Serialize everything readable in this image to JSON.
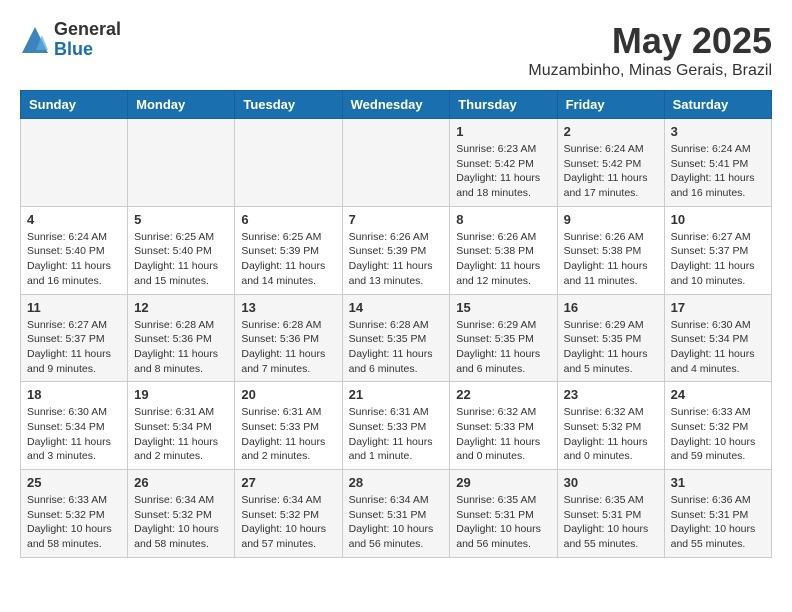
{
  "logo": {
    "general": "General",
    "blue": "Blue"
  },
  "title": "May 2025",
  "location": "Muzambinho, Minas Gerais, Brazil",
  "headers": [
    "Sunday",
    "Monday",
    "Tuesday",
    "Wednesday",
    "Thursday",
    "Friday",
    "Saturday"
  ],
  "weeks": [
    [
      {
        "day": "",
        "info": ""
      },
      {
        "day": "",
        "info": ""
      },
      {
        "day": "",
        "info": ""
      },
      {
        "day": "",
        "info": ""
      },
      {
        "day": "1",
        "info": "Sunrise: 6:23 AM\nSunset: 5:42 PM\nDaylight: 11 hours and 18 minutes."
      },
      {
        "day": "2",
        "info": "Sunrise: 6:24 AM\nSunset: 5:42 PM\nDaylight: 11 hours and 17 minutes."
      },
      {
        "day": "3",
        "info": "Sunrise: 6:24 AM\nSunset: 5:41 PM\nDaylight: 11 hours and 16 minutes."
      }
    ],
    [
      {
        "day": "4",
        "info": "Sunrise: 6:24 AM\nSunset: 5:40 PM\nDaylight: 11 hours and 16 minutes."
      },
      {
        "day": "5",
        "info": "Sunrise: 6:25 AM\nSunset: 5:40 PM\nDaylight: 11 hours and 15 minutes."
      },
      {
        "day": "6",
        "info": "Sunrise: 6:25 AM\nSunset: 5:39 PM\nDaylight: 11 hours and 14 minutes."
      },
      {
        "day": "7",
        "info": "Sunrise: 6:26 AM\nSunset: 5:39 PM\nDaylight: 11 hours and 13 minutes."
      },
      {
        "day": "8",
        "info": "Sunrise: 6:26 AM\nSunset: 5:38 PM\nDaylight: 11 hours and 12 minutes."
      },
      {
        "day": "9",
        "info": "Sunrise: 6:26 AM\nSunset: 5:38 PM\nDaylight: 11 hours and 11 minutes."
      },
      {
        "day": "10",
        "info": "Sunrise: 6:27 AM\nSunset: 5:37 PM\nDaylight: 11 hours and 10 minutes."
      }
    ],
    [
      {
        "day": "11",
        "info": "Sunrise: 6:27 AM\nSunset: 5:37 PM\nDaylight: 11 hours and 9 minutes."
      },
      {
        "day": "12",
        "info": "Sunrise: 6:28 AM\nSunset: 5:36 PM\nDaylight: 11 hours and 8 minutes."
      },
      {
        "day": "13",
        "info": "Sunrise: 6:28 AM\nSunset: 5:36 PM\nDaylight: 11 hours and 7 minutes."
      },
      {
        "day": "14",
        "info": "Sunrise: 6:28 AM\nSunset: 5:35 PM\nDaylight: 11 hours and 6 minutes."
      },
      {
        "day": "15",
        "info": "Sunrise: 6:29 AM\nSunset: 5:35 PM\nDaylight: 11 hours and 6 minutes."
      },
      {
        "day": "16",
        "info": "Sunrise: 6:29 AM\nSunset: 5:35 PM\nDaylight: 11 hours and 5 minutes."
      },
      {
        "day": "17",
        "info": "Sunrise: 6:30 AM\nSunset: 5:34 PM\nDaylight: 11 hours and 4 minutes."
      }
    ],
    [
      {
        "day": "18",
        "info": "Sunrise: 6:30 AM\nSunset: 5:34 PM\nDaylight: 11 hours and 3 minutes."
      },
      {
        "day": "19",
        "info": "Sunrise: 6:31 AM\nSunset: 5:34 PM\nDaylight: 11 hours and 2 minutes."
      },
      {
        "day": "20",
        "info": "Sunrise: 6:31 AM\nSunset: 5:33 PM\nDaylight: 11 hours and 2 minutes."
      },
      {
        "day": "21",
        "info": "Sunrise: 6:31 AM\nSunset: 5:33 PM\nDaylight: 11 hours and 1 minute."
      },
      {
        "day": "22",
        "info": "Sunrise: 6:32 AM\nSunset: 5:33 PM\nDaylight: 11 hours and 0 minutes."
      },
      {
        "day": "23",
        "info": "Sunrise: 6:32 AM\nSunset: 5:32 PM\nDaylight: 11 hours and 0 minutes."
      },
      {
        "day": "24",
        "info": "Sunrise: 6:33 AM\nSunset: 5:32 PM\nDaylight: 10 hours and 59 minutes."
      }
    ],
    [
      {
        "day": "25",
        "info": "Sunrise: 6:33 AM\nSunset: 5:32 PM\nDaylight: 10 hours and 58 minutes."
      },
      {
        "day": "26",
        "info": "Sunrise: 6:34 AM\nSunset: 5:32 PM\nDaylight: 10 hours and 58 minutes."
      },
      {
        "day": "27",
        "info": "Sunrise: 6:34 AM\nSunset: 5:32 PM\nDaylight: 10 hours and 57 minutes."
      },
      {
        "day": "28",
        "info": "Sunrise: 6:34 AM\nSunset: 5:31 PM\nDaylight: 10 hours and 56 minutes."
      },
      {
        "day": "29",
        "info": "Sunrise: 6:35 AM\nSunset: 5:31 PM\nDaylight: 10 hours and 56 minutes."
      },
      {
        "day": "30",
        "info": "Sunrise: 6:35 AM\nSunset: 5:31 PM\nDaylight: 10 hours and 55 minutes."
      },
      {
        "day": "31",
        "info": "Sunrise: 6:36 AM\nSunset: 5:31 PM\nDaylight: 10 hours and 55 minutes."
      }
    ]
  ]
}
